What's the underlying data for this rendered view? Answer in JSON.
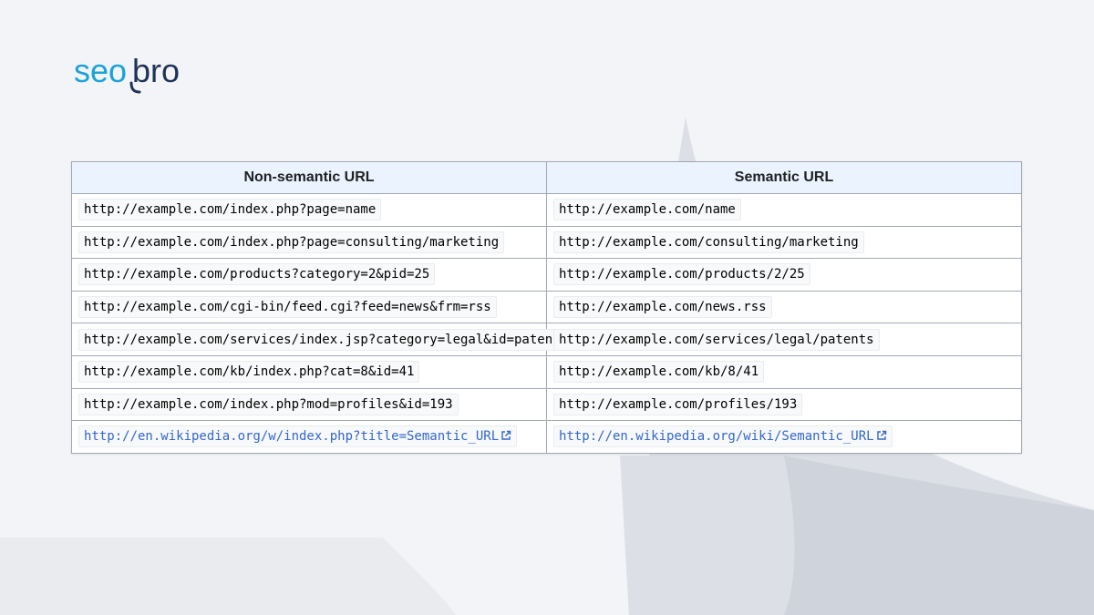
{
  "brand": {
    "logo_seo": "seo",
    "logo_bro": "bro",
    "seo_color": "#1aa3d9",
    "bro_color": "#1e3358"
  },
  "table": {
    "headers": [
      "Non-semantic URL",
      "Semantic URL"
    ],
    "rows": [
      [
        "http://example.com/index.php?page=name",
        "http://example.com/name"
      ],
      [
        "http://example.com/index.php?page=consulting/marketing",
        "http://example.com/consulting/marketing"
      ],
      [
        "http://example.com/products?category=2&pid=25",
        "http://example.com/products/2/25"
      ],
      [
        "http://example.com/cgi-bin/feed.cgi?feed=news&frm=rss",
        "http://example.com/news.rss"
      ],
      [
        "http://example.com/services/index.jsp?category=legal&id=patents",
        "http://example.com/services/legal/patents"
      ],
      [
        "http://example.com/kb/index.php?cat=8&id=41",
        "http://example.com/kb/8/41"
      ],
      [
        "http://example.com/index.php?mod=profiles&id=193",
        "http://example.com/profiles/193"
      ],
      [
        "http://en.wikipedia.org/w/index.php?title=Semantic_URL",
        "http://en.wikipedia.org/wiki/Semantic_URL"
      ]
    ],
    "link_color": "#3366cc",
    "header_bg": "#eaf3ff",
    "external_link_icon": "external-link-icon"
  }
}
